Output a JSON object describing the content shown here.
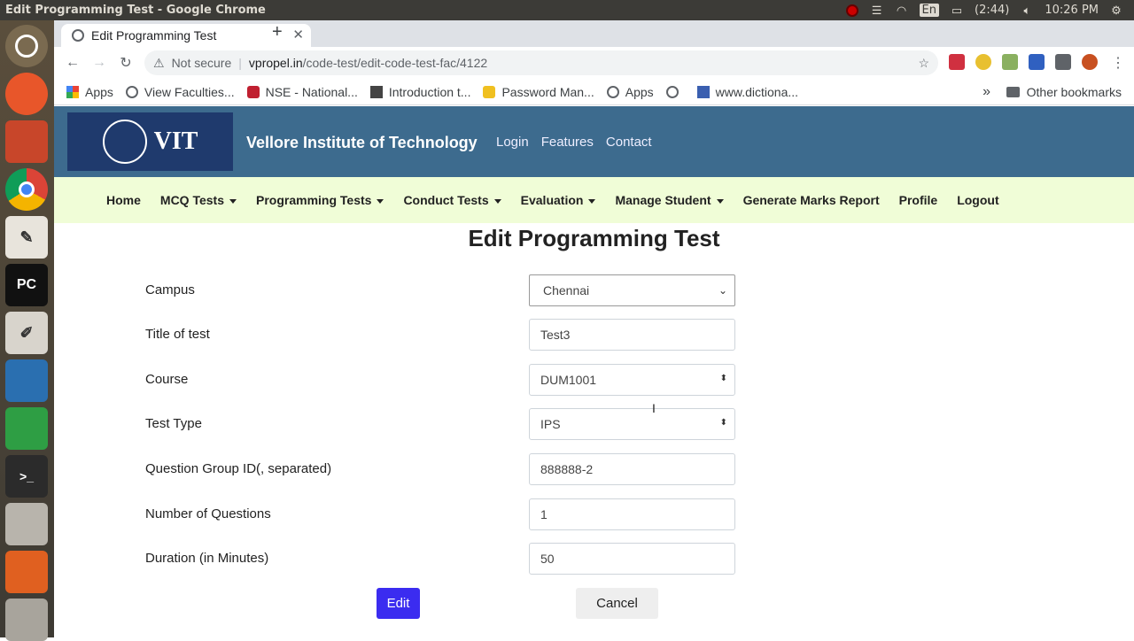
{
  "os": {
    "window_title": "Edit Programming Test - Google Chrome",
    "battery": "(2:44)",
    "keyboard": "En",
    "clock": "10:26 PM"
  },
  "browser": {
    "tab_title": "Edit Programming Test",
    "tab_close": "✕",
    "new_tab": "+",
    "not_secure": "Not secure",
    "url_host": "vpropel.in",
    "url_path": "/code-test/edit-code-test-fac/4122",
    "bookmarks": [
      "Apps",
      "View Faculties...",
      "NSE - National...",
      "Introduction t...",
      "Password Man...",
      "Apps",
      "",
      "www.dictiona..."
    ],
    "other_bookmarks": "Other bookmarks",
    "more": "»"
  },
  "site": {
    "logo_text": "VIT",
    "title": "Vellore Institute of Technology",
    "links": [
      "Login",
      "Features",
      "Contact"
    ]
  },
  "nav": {
    "items": [
      {
        "label": "Home",
        "dropdown": false
      },
      {
        "label": "MCQ Tests",
        "dropdown": true
      },
      {
        "label": "Programming Tests",
        "dropdown": true
      },
      {
        "label": "Conduct Tests",
        "dropdown": true
      },
      {
        "label": "Evaluation",
        "dropdown": true
      },
      {
        "label": "Manage Student",
        "dropdown": true
      },
      {
        "label": "Generate Marks Report",
        "dropdown": false
      },
      {
        "label": "Profile",
        "dropdown": false
      },
      {
        "label": "Logout",
        "dropdown": false
      }
    ]
  },
  "page": {
    "title": "Edit Programming Test"
  },
  "form": {
    "campus": {
      "label": "Campus",
      "value": "Chennai"
    },
    "title": {
      "label": "Title of test",
      "value": "Test3"
    },
    "course": {
      "label": "Course",
      "value": "DUM1001"
    },
    "test_type": {
      "label": "Test Type",
      "value": "IPS"
    },
    "group_id": {
      "label": "Question Group ID(, separated)",
      "value": "888888-2"
    },
    "num_questions": {
      "label": "Number of Questions",
      "value": "1"
    },
    "duration": {
      "label": "Duration (in Minutes)",
      "value": "50"
    },
    "edit_label": "Edit",
    "cancel_label": "Cancel"
  },
  "colors": {
    "header_bg": "#3d6b8e",
    "nav_bg": "#f0fdd7",
    "edit_button": "#3b2cf0"
  }
}
